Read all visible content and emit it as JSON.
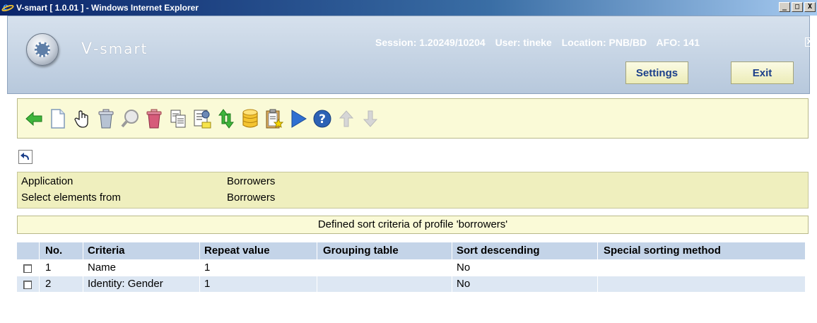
{
  "window": {
    "title": "V-smart [ 1.0.01 ] - Windows Internet Explorer",
    "controls": [
      "_",
      "□",
      "X"
    ]
  },
  "header": {
    "brand": "V-smart",
    "session": "Session: 1.20249/10204",
    "user": "User: tineke",
    "location": "Location: PNB/BD",
    "afo": "AFO: 141",
    "close": "X",
    "settings_label": "Settings",
    "exit_label": "Exit"
  },
  "toolbar": {
    "icons": [
      "back-arrow-icon",
      "new-document-icon",
      "hand-select-icon",
      "delete-bin-icon",
      "search-icon",
      "trash-red-icon",
      "copy-icon",
      "properties-icon",
      "swap-arrows-icon",
      "database-icon",
      "clipboard-icon",
      "play-icon",
      "help-icon",
      "arrow-up-icon",
      "arrow-down-icon"
    ]
  },
  "info": {
    "rows": [
      {
        "label": "Application",
        "value": "Borrowers"
      },
      {
        "label": "Select elements from",
        "value": "Borrowers"
      }
    ]
  },
  "caption": "Defined sort criteria of profile 'borrowers'",
  "table": {
    "headers": [
      "No.",
      "Criteria",
      "Repeat value",
      "Grouping table",
      "Sort descending",
      "Special sorting method"
    ],
    "rows": [
      {
        "no": "1",
        "criteria": "Name",
        "repeat": "1",
        "grouping": "",
        "descending": "No",
        "special": ""
      },
      {
        "no": "2",
        "criteria": "Identity: Gender",
        "repeat": "1",
        "grouping": "",
        "descending": "No",
        "special": ""
      }
    ]
  }
}
